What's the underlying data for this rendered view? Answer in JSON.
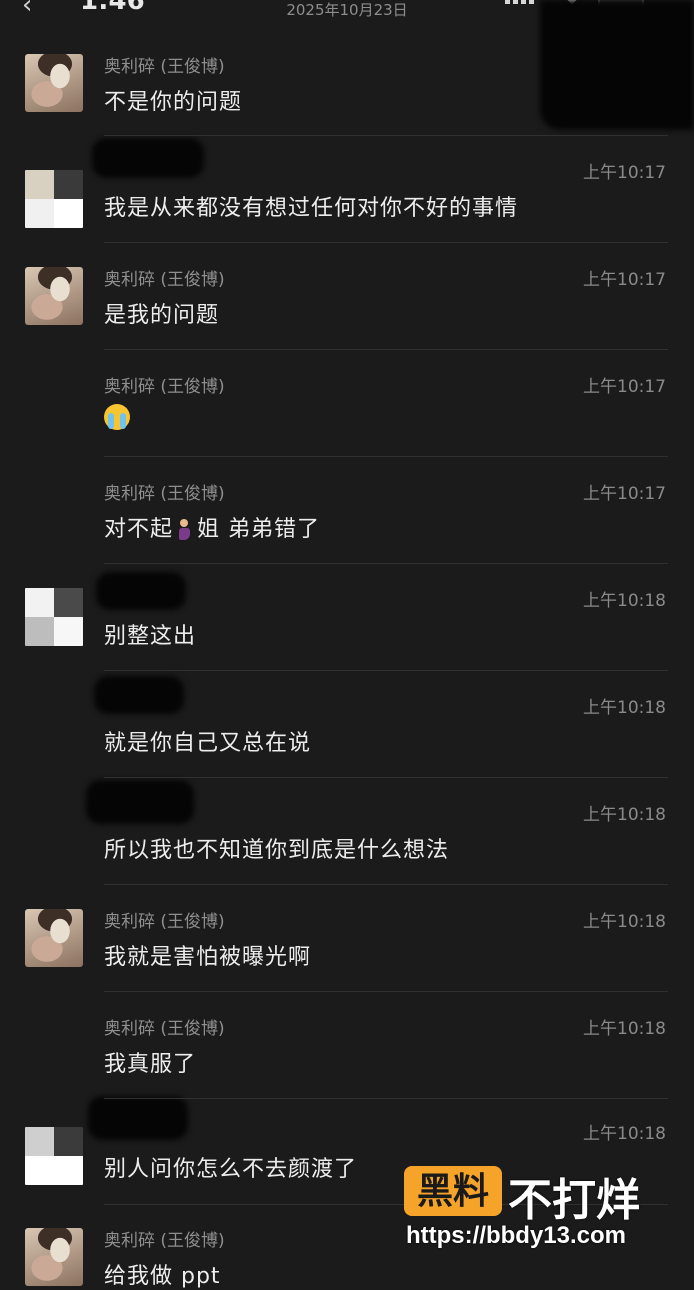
{
  "status_bar": {
    "time": "1:46",
    "date": "2025年10月23日"
  },
  "messages": [
    {
      "sender": "奥利碎 (王俊博)",
      "time": "",
      "text": "不是你的问题",
      "avatar": "photo"
    },
    {
      "sender": "",
      "time": "上午10:17",
      "text": "我是从来都没有想过任何对你不好的事情",
      "avatar": "blocks"
    },
    {
      "sender": "奥利碎 (王俊博)",
      "time": "上午10:17",
      "text": "是我的问题",
      "avatar": "photo"
    },
    {
      "sender": "奥利碎 (王俊博)",
      "time": "上午10:17",
      "emoji": "loudly-crying-face",
      "avatar": "none"
    },
    {
      "sender": "奥利碎 (王俊博)",
      "time": "上午10:17",
      "text_before": "对不起",
      "emoji": "person-kneeling",
      "text_after": "姐 弟弟错了",
      "avatar": "none"
    },
    {
      "sender": "",
      "time": "上午10:18",
      "text": "别整这出",
      "avatar": "blocks"
    },
    {
      "sender": "",
      "time": "上午10:18",
      "text": "就是你自己又总在说",
      "avatar": "none"
    },
    {
      "sender": "",
      "time": "上午10:18",
      "text": "所以我也不知道你到底是什么想法",
      "avatar": "none"
    },
    {
      "sender": "奥利碎 (王俊博)",
      "time": "上午10:18",
      "text": "我就是害怕被曝光啊",
      "avatar": "photo"
    },
    {
      "sender": "奥利碎 (王俊博)",
      "time": "上午10:18",
      "text": "我真服了",
      "avatar": "none"
    },
    {
      "sender": "",
      "time": "上午10:18",
      "text": "别人问你怎么不去颜渡了",
      "avatar": "blocks"
    },
    {
      "sender": "奥利碎 (王俊博)",
      "time": "",
      "text": "给我做 ppt",
      "avatar": "photo"
    }
  ],
  "watermark": {
    "badge": "黑料",
    "title": "不打烊",
    "url": "https://bbdy13.com"
  },
  "colors": {
    "background": "#1b1b1b",
    "text": "#ededed",
    "meta": "#8a8a8a",
    "watermark_badge": "#f6a32a"
  }
}
